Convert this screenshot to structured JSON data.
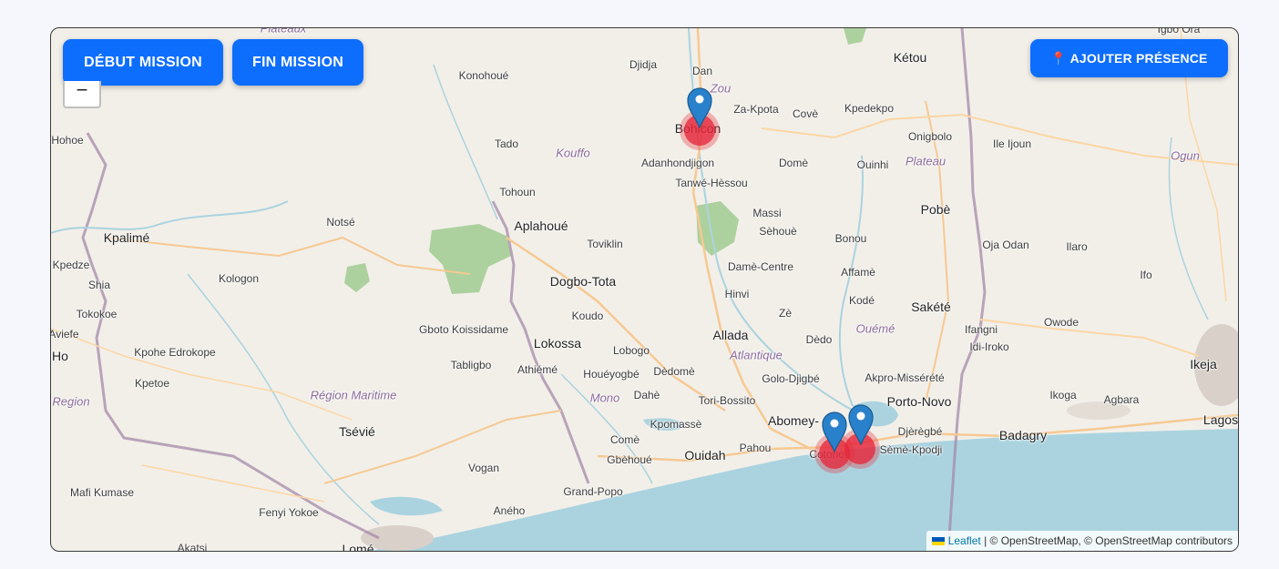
{
  "buttons": {
    "start_mission": "DÉBUT MISSION",
    "end_mission": "FIN MISSION",
    "add_presence": "AJOUTER PRÉSENCE",
    "zoom_out": "−"
  },
  "attribution": {
    "leaflet": "Leaflet",
    "rest": "| © OpenStreetMap, © OpenStreetMap contributors"
  },
  "places": [
    "Konohoué",
    "Djidja",
    "Dan",
    "Kétou",
    "Za-Kpota",
    "Covè",
    "Kpedekpo",
    "Igbo Ora",
    "Hohoe",
    "Tado",
    "Kouffo",
    "Adanhondjigon",
    "Domè",
    "Ouinhi",
    "Plateau",
    "Onigbolo",
    "Ile Ijoun",
    "Ogun",
    "Tanwé-Hèssou",
    "Tohoun",
    "Kpalimé",
    "Notsé",
    "Aplahoué",
    "Massi",
    "Sèhouè",
    "Pobè",
    "Toviklin",
    "Bonou",
    "Oja Odan",
    "Ilaro",
    "Kpedze",
    "Kologon",
    "Dogbo-Tota",
    "Damè-Centre",
    "Affamè",
    "Shia",
    "Hinvi",
    "Kodé",
    "Sakété",
    "Ifo",
    "Tokokoe",
    "Koudo",
    "Zè",
    "Ifangni",
    "Owode",
    "Gboto Koissidame",
    "Lokossa",
    "Allada",
    "Dèdo",
    "Idi-Iroko",
    "Aviefe",
    "Kpohe Edrokope",
    "Lobogo",
    "Atlantique",
    "Ouémé",
    "Ho",
    "Tabligbo",
    "Athiémé",
    "Houéyogbé",
    "Dèdomè",
    "Golo-Djigbé",
    "Akpro-Missérété",
    "Ikeja",
    "Kpetoe",
    "Région Maritime",
    "Mono",
    "Dahè",
    "Tori-Bossito",
    "Porto-Novo",
    "Ikoga",
    "Agbara",
    "Region",
    "Kpomassè",
    "Abomey-",
    "Djèrègbé",
    "Lagos",
    "Tsévié",
    "Comè",
    "Pahou",
    "Cotonou",
    "Sèmè-Kpodji",
    "Badagry",
    "Ouidah",
    "Gbèhoué",
    "Vogan",
    "Mafi Kumase",
    "Grand-Popo",
    "Fenyi Yokoe",
    "Aného",
    "Akatsi",
    "Lomé",
    "Bohicon",
    "Plateaux",
    "Zou"
  ]
}
